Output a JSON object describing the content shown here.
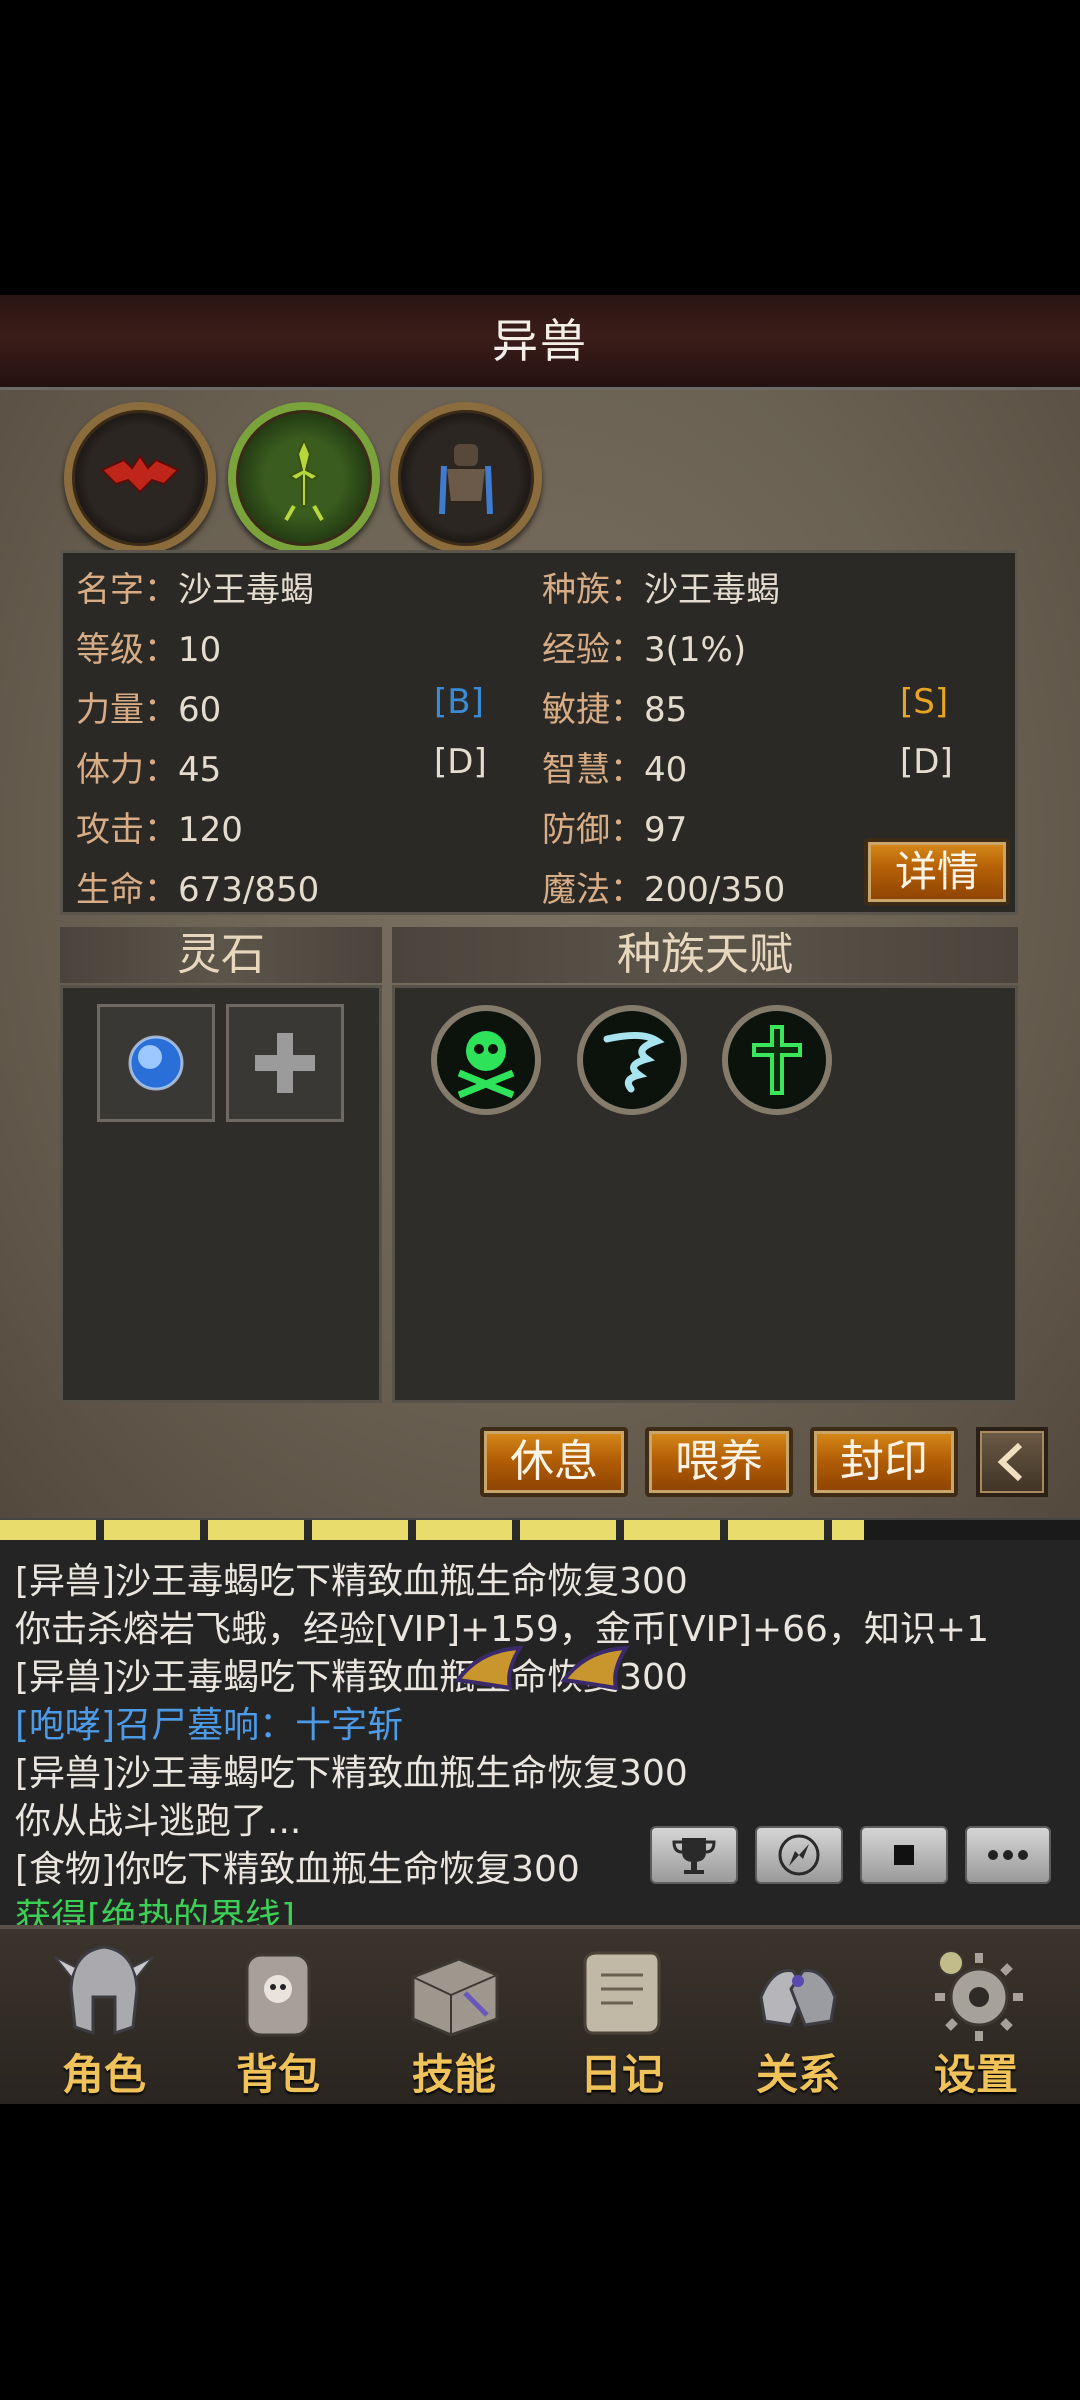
{
  "header": {
    "title": "异兽"
  },
  "pets": [
    {
      "name": "red-bat-pet",
      "active": false
    },
    {
      "name": "green-mantis-pet",
      "active": true
    },
    {
      "name": "blue-armored-pet",
      "active": false
    }
  ],
  "stats": {
    "name_label": "名字：",
    "name_value": "沙王毒蝎",
    "race_label": "种族：",
    "race_value": "沙王毒蝎",
    "level_label": "等级：",
    "level_value": "10",
    "exp_label": "经验：",
    "exp_value": "3(1%)",
    "str_label": "力量：",
    "str_value": "60",
    "str_grade": "[B]",
    "agi_label": "敏捷：",
    "agi_value": "85",
    "agi_grade": "[S]",
    "vit_label": "体力：",
    "vit_value": "45",
    "vit_grade": "[D]",
    "int_label": "智慧：",
    "int_value": "40",
    "int_grade": "[D]",
    "atk_label": "攻击：",
    "atk_value": "120",
    "def_label": "防御：",
    "def_value": "97",
    "hp_label": "生命：",
    "hp_value": "673/850",
    "mp_label": "魔法：",
    "mp_value": "200/350",
    "details_button": "详情"
  },
  "sections": {
    "spirit_stone": "灵石",
    "race_talent": "种族天赋"
  },
  "actions": {
    "rest": "休息",
    "feed": "喂养",
    "seal": "封印"
  },
  "progress": {
    "fraction": 0.8
  },
  "log": [
    "[异兽]沙王毒蝎吃下精致血瓶生命恢复300",
    "你击杀熔岩飞蛾，经验[VIP]+159，金币[VIP]+66，知识+1",
    "[异兽]沙王毒蝎吃下精致血瓶生命恢复300",
    "[咆哮]召尸墓响：十字斩",
    "[异兽]沙王毒蝎吃下精致血瓶生命恢复300",
    "你从战斗逃跑了...",
    "[食物]你吃下精致血瓶生命恢复300",
    "获得[绝热的界线]"
  ],
  "nav": [
    {
      "label": "角色",
      "icon": "helmet-icon"
    },
    {
      "label": "背包",
      "icon": "backpack-icon"
    },
    {
      "label": "技能",
      "icon": "skill-book-icon"
    },
    {
      "label": "日记",
      "icon": "scroll-icon"
    },
    {
      "label": "关系",
      "icon": "gauntlet-icon"
    },
    {
      "label": "设置",
      "icon": "gear-icon"
    }
  ],
  "colors": {
    "gold": "#f0c25a",
    "label": "#d8ad86",
    "grade_b": "#3a8cd6",
    "grade_s": "#e8a524"
  }
}
